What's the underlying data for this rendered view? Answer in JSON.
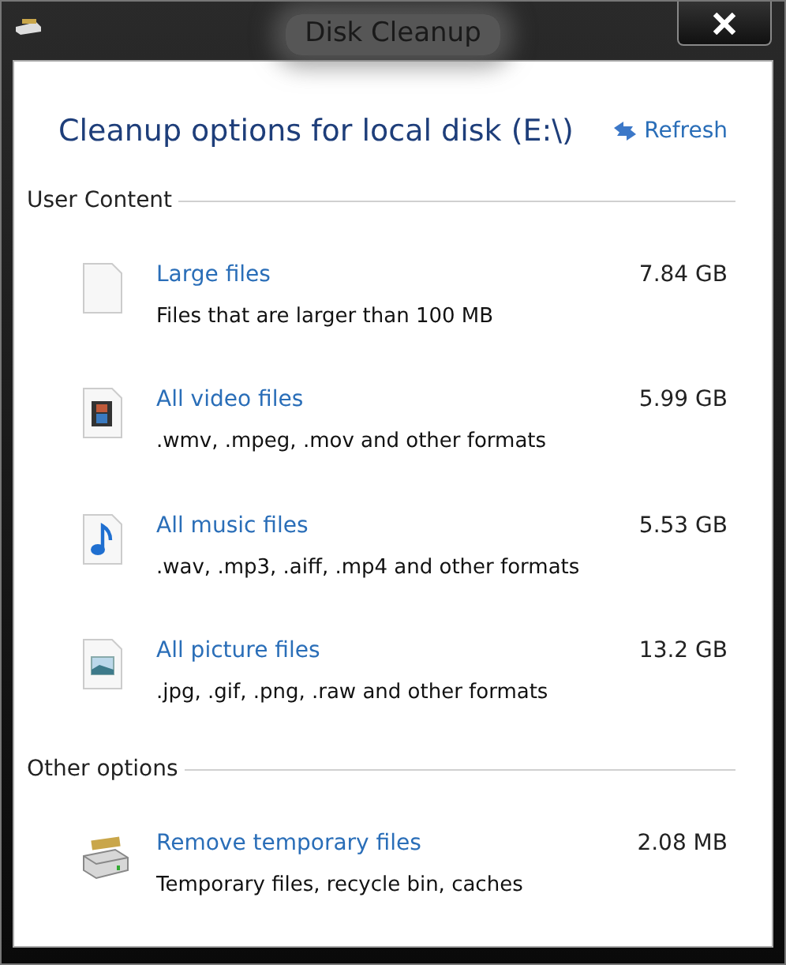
{
  "window": {
    "title": "Disk Cleanup"
  },
  "heading": "Cleanup options for local disk (E:\\)",
  "refresh": "Refresh",
  "sections": [
    {
      "label": "User Content",
      "items": [
        {
          "kind": "blank",
          "title": "Large files",
          "size": "7.84 GB",
          "description": "Files that are larger than 100 MB"
        },
        {
          "kind": "video",
          "title": "All video files",
          "size": "5.99 GB",
          "description": ".wmv, .mpeg, .mov and other formats"
        },
        {
          "kind": "music",
          "title": "All music files",
          "size": "5.53 GB",
          "description": ".wav, .mp3, .aiff, .mp4 and other formats"
        },
        {
          "kind": "picture",
          "title": "All picture files",
          "size": "13.2 GB",
          "description": ".jpg, .gif, .png, .raw and other formats"
        }
      ]
    },
    {
      "label": "Other options",
      "items": [
        {
          "kind": "drive",
          "title": "Remove temporary files",
          "size": "2.08 MB",
          "description": "Temporary files, recycle bin, caches"
        }
      ]
    }
  ]
}
